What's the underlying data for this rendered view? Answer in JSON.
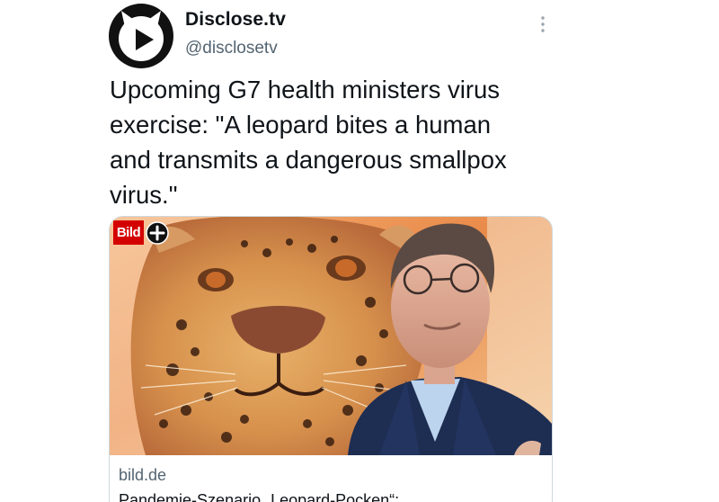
{
  "tweet": {
    "author": {
      "display_name": "Disclose.tv",
      "handle": "@disclosetv"
    },
    "text": "Upcoming G7 health ministers virus\nexercise: \"A leopard bites a human\nand transmits a dangerous smallpox\nvirus.\"",
    "more_icon": "vertical-dots-icon"
  },
  "card": {
    "badge": {
      "label": "Bild",
      "icon": "plus-circle-icon",
      "color": "#d40000"
    },
    "domain": "bild.de",
    "title": "Pandemie-Szenario „Leopard-Pocken“:"
  },
  "colors": {
    "text_primary": "#0f1419",
    "text_secondary": "#536471",
    "card_border": "#cfd9de"
  }
}
